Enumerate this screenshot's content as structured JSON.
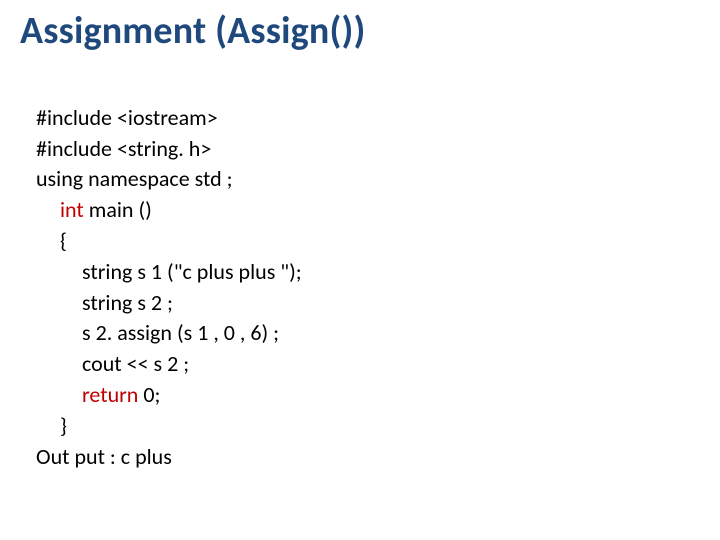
{
  "title": "Assignment (Assign())",
  "code": {
    "l1": "#include <iostream>",
    "l2": "#include <string. h>",
    "l3": "using namespace std ;",
    "l4_kw": "int ",
    "l4_rest": "main ()",
    "l5": "{",
    "l6": "string s 1 (\"c plus plus \");",
    "l7": "string s 2 ;",
    "l8": "s 2. assign (s 1 , 0 , 6) ;",
    "l9": "cout << s 2 ;",
    "l10_kw": "return ",
    "l10_rest": "0;",
    "l11": "}",
    "l12": "Out put : c plus"
  }
}
